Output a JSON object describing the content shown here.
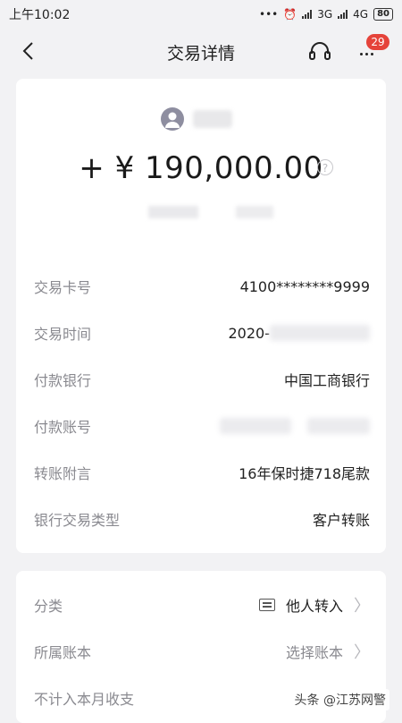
{
  "status_bar": {
    "time": "上午10:02",
    "network_1": "3G",
    "network_2": "4G",
    "battery": "80"
  },
  "nav": {
    "title": "交易详情",
    "badge_count": "29"
  },
  "transaction": {
    "amount": "+ ¥ 190,000.00",
    "rows": [
      {
        "label": "交易卡号",
        "value": "4100********9999"
      },
      {
        "label": "交易时间",
        "value": "2020-"
      },
      {
        "label": "付款银行",
        "value": "中国工商银行"
      },
      {
        "label": "付款账号",
        "value": ""
      },
      {
        "label": "转账附言",
        "value": "16年保时捷718尾款"
      },
      {
        "label": "银行交易类型",
        "value": "客户转账"
      }
    ]
  },
  "settings": {
    "category_label": "分类",
    "category_value": "他人转入",
    "ledger_label": "所属账本",
    "ledger_value": "选择账本",
    "exclude_label": "不计入本月收支"
  },
  "watermark": "头条 @江苏网警"
}
